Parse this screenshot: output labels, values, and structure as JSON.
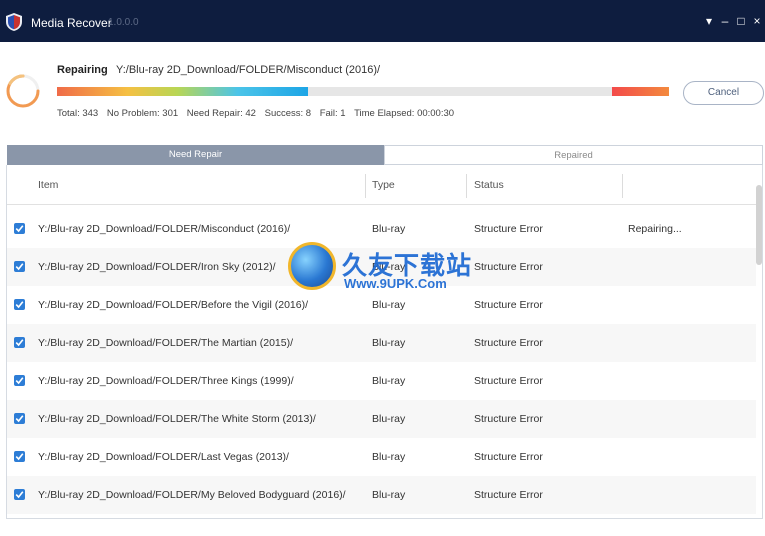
{
  "window": {
    "title": "Media Recover",
    "version": "1.0.0.0",
    "controls": {
      "menu": "▾",
      "minimize": "–",
      "maximize": "□",
      "close": "×"
    }
  },
  "progress": {
    "label": "Repairing",
    "path": "Y:/Blu-ray 2D_Download/FOLDER/Misconduct (2016)/",
    "fraction": 0.41,
    "stats": {
      "total": "Total: 343",
      "no_problem": "No Problem: 301",
      "need_repair": "Need Repair: 42",
      "success": "Success: 8",
      "fail": "Fail: 1",
      "elapsed": "Time Elapsed: 00:00:30"
    },
    "cancel_label": "Cancel"
  },
  "tabs": [
    {
      "label": "Need Repair",
      "active": true
    },
    {
      "label": "Repaired",
      "active": false
    }
  ],
  "table": {
    "columns": [
      "Item",
      "Type",
      "Status"
    ],
    "rows": [
      {
        "item": "Y:/Blu-ray 2D_Download/FOLDER/Misconduct (2016)/",
        "type": "Blu-ray",
        "status": "Structure Error",
        "progress": "Repairing..."
      },
      {
        "item": "Y:/Blu-ray 2D_Download/FOLDER/Iron Sky (2012)/",
        "type": "Blu-ray",
        "status": "Structure Error",
        "progress": ""
      },
      {
        "item": "Y:/Blu-ray 2D_Download/FOLDER/Before the Vigil (2016)/",
        "type": "Blu-ray",
        "status": "Structure Error",
        "progress": ""
      },
      {
        "item": "Y:/Blu-ray 2D_Download/FOLDER/The Martian (2015)/",
        "type": "Blu-ray",
        "status": "Structure Error",
        "progress": ""
      },
      {
        "item": "Y:/Blu-ray 2D_Download/FOLDER/Three Kings (1999)/",
        "type": "Blu-ray",
        "status": "Structure Error",
        "progress": ""
      },
      {
        "item": "Y:/Blu-ray 2D_Download/FOLDER/The White Storm (2013)/",
        "type": "Blu-ray",
        "status": "Structure Error",
        "progress": ""
      },
      {
        "item": "Y:/Blu-ray 2D_Download/FOLDER/Last Vegas (2013)/",
        "type": "Blu-ray",
        "status": "Structure Error",
        "progress": ""
      },
      {
        "item": "Y:/Blu-ray 2D_Download/FOLDER/My Beloved Bodyguard (2016)/",
        "type": "Blu-ray",
        "status": "Structure Error",
        "progress": ""
      }
    ]
  },
  "watermark": {
    "title": "久友下载站",
    "url": "Www.9UPK.Com"
  },
  "colors": {
    "titlebar": "#0e1d3f",
    "accent": "#2d7dd6",
    "tab_active": "#8a96a9"
  }
}
